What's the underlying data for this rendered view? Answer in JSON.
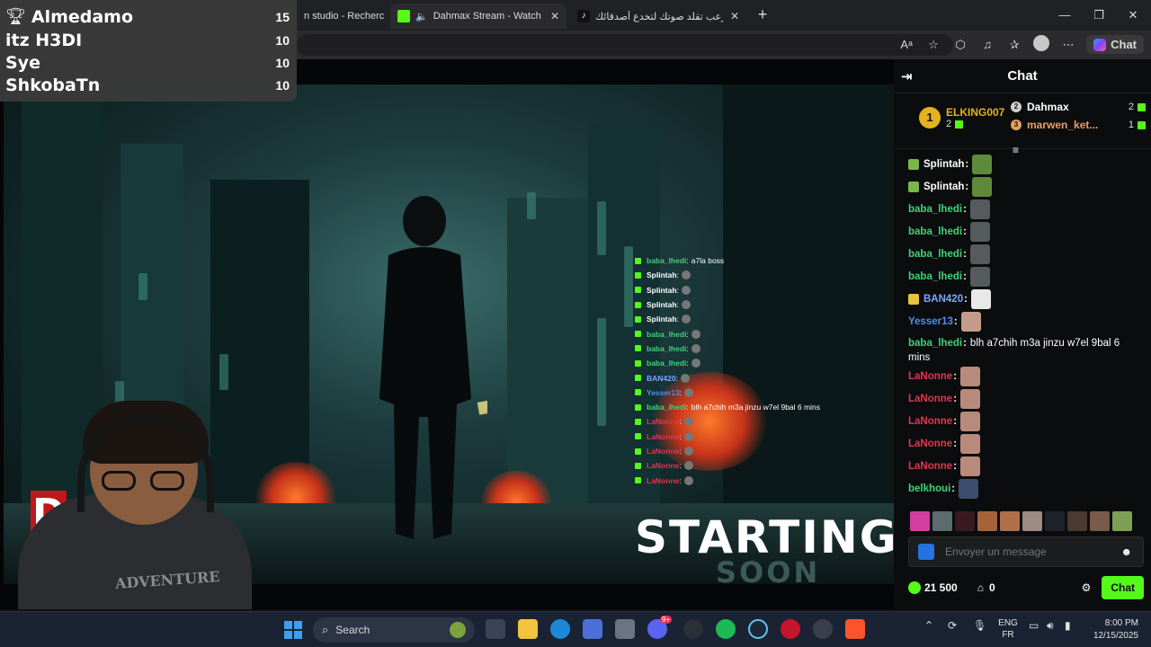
{
  "browser": {
    "tabs": [
      {
        "label": "n studio - Recherc",
        "active": false
      },
      {
        "label": "Dahmax Stream - Watch Live",
        "active": true
      },
      {
        "label": "لعبة رعب تقلد صوتك لتخدع أصدقائك",
        "active": false
      }
    ],
    "copilot_label": "Chat"
  },
  "leaderboard": [
    {
      "name": "Almedamo",
      "score": "15"
    },
    {
      "name": "itz H3DI",
      "score": "10"
    },
    {
      "name": "Sye",
      "score": "10"
    },
    {
      "name": "ShkobaTn",
      "score": "10"
    }
  ],
  "stream": {
    "starting": "STARTING",
    "soon": "SOON",
    "overlay_chat": [
      {
        "user": "baba_lhedi",
        "color": "#3fd17a",
        "text": "a7la boss"
      },
      {
        "user": "Splintah",
        "color": "#ffffff",
        "text": ""
      },
      {
        "user": "Splintah",
        "color": "#ffffff",
        "text": ""
      },
      {
        "user": "Splintah",
        "color": "#ffffff",
        "text": ""
      },
      {
        "user": "Splintah",
        "color": "#ffffff",
        "text": ""
      },
      {
        "user": "baba_lhedi",
        "color": "#3fd17a",
        "text": ""
      },
      {
        "user": "baba_lhedi",
        "color": "#3fd17a",
        "text": ""
      },
      {
        "user": "baba_lhedi",
        "color": "#3fd17a",
        "text": ""
      },
      {
        "user": "BAN420",
        "color": "#7aa7ff",
        "text": ""
      },
      {
        "user": "Yesser13",
        "color": "#4f8df0",
        "text": ""
      },
      {
        "user": "baba_lhedi",
        "color": "#3fd17a",
        "text": "blh a7chih m3a jinzu w7el 9bal 6 mins"
      },
      {
        "user": "LaNonne",
        "color": "#e0364f",
        "text": ""
      },
      {
        "user": "LaNonne",
        "color": "#e0364f",
        "text": ""
      },
      {
        "user": "LaNonne",
        "color": "#e0364f",
        "text": ""
      },
      {
        "user": "LaNonne",
        "color": "#e0364f",
        "text": ""
      },
      {
        "user": "LaNonne",
        "color": "#e0364f",
        "text": ""
      }
    ],
    "webcam_shirt_text": "ADVENTURE"
  },
  "chat": {
    "title": "Chat",
    "top_gifters": [
      {
        "rank": "1",
        "name": "ELKING007",
        "count": "2",
        "color": "#e3b21d"
      },
      {
        "rank": "2",
        "name": "Dahmax",
        "count": "2",
        "color": "#ffffff"
      },
      {
        "rank": "3",
        "name": "marwen_ket...",
        "count": "1",
        "color": "#e8a060"
      }
    ],
    "messages": [
      {
        "user": "Splintah",
        "color": "#ffffff",
        "text": "",
        "badge": "#7ab648"
      },
      {
        "user": "Splintah",
        "color": "#ffffff",
        "text": "",
        "badge": "#7ab648"
      },
      {
        "user": "baba_lhedi",
        "color": "#3fd17a",
        "text": ""
      },
      {
        "user": "baba_lhedi",
        "color": "#3fd17a",
        "text": ""
      },
      {
        "user": "baba_lhedi",
        "color": "#3fd17a",
        "text": ""
      },
      {
        "user": "baba_lhedi",
        "color": "#3fd17a",
        "text": ""
      },
      {
        "user": "BAN420",
        "color": "#7aa7ff",
        "text": "",
        "badge": "#e7c23a"
      },
      {
        "user": "Yesser13",
        "color": "#4f8df0",
        "text": ""
      },
      {
        "user": "baba_lhedi",
        "color": "#3fd17a",
        "text": "blh a7chih m3a jinzu w7el 9bal 6 mins"
      },
      {
        "user": "LaNonne",
        "color": "#e0364f",
        "text": ""
      },
      {
        "user": "LaNonne",
        "color": "#e0364f",
        "text": ""
      },
      {
        "user": "LaNonne",
        "color": "#e0364f",
        "text": ""
      },
      {
        "user": "LaNonne",
        "color": "#e0364f",
        "text": ""
      },
      {
        "user": "LaNonne",
        "color": "#e0364f",
        "text": ""
      },
      {
        "user": "belkhoui",
        "color": "#3fd17a",
        "text": ""
      }
    ],
    "input_placeholder": "Envoyer un message",
    "points": "21 500",
    "store_count": "0",
    "send_label": "Chat",
    "accent": "#53fc18"
  },
  "taskbar": {
    "search_label": "Search",
    "lang_top": "ENG",
    "lang_bottom": "FR",
    "time": "8:00 PM",
    "date": "12/15/2025",
    "discord_badge": "9+"
  }
}
